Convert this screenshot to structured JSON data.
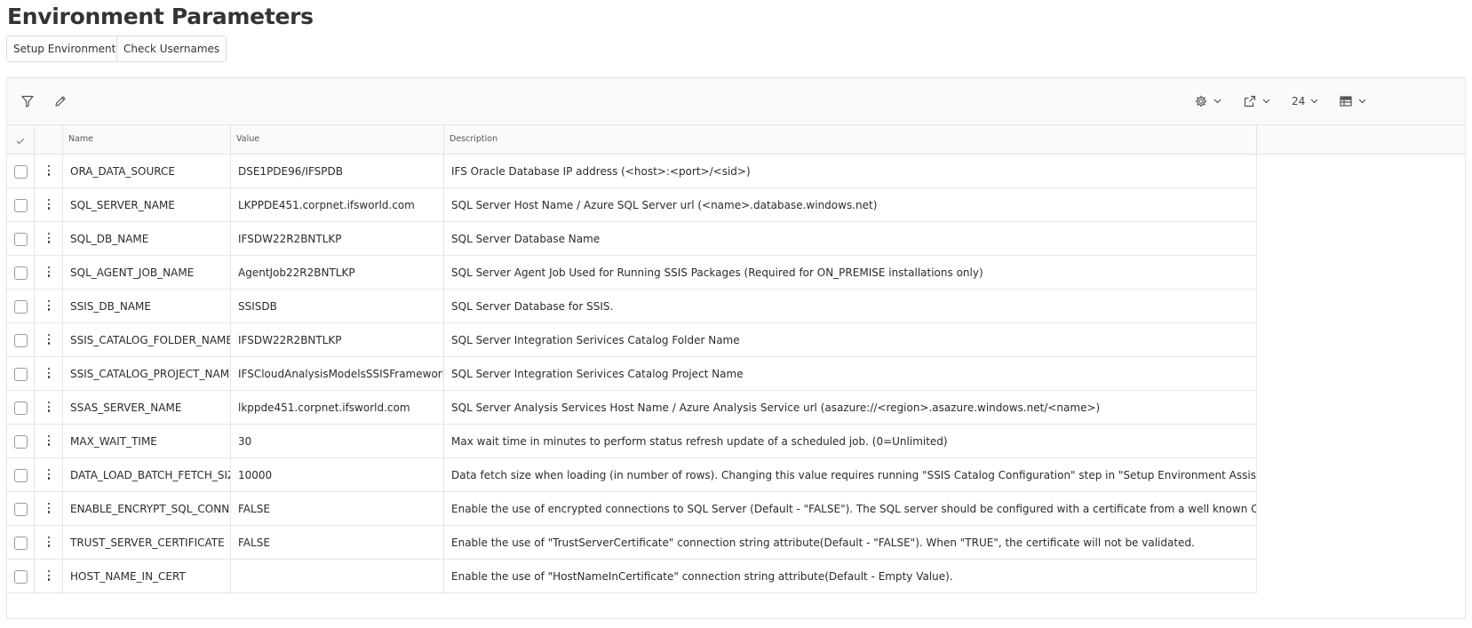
{
  "page": {
    "title": "Environment Parameters"
  },
  "commands": {
    "setup_environment": "Setup Environment",
    "check_usernames": "Check Usernames"
  },
  "toolbar": {
    "page_size": "24",
    "icons": [
      "filter-icon",
      "edit-icon",
      "settings-icon",
      "export-icon",
      "table-view-icon"
    ]
  },
  "table": {
    "columns": {
      "name": "Name",
      "value": "Value",
      "description": "Description"
    },
    "rows": [
      {
        "name": "ORA_DATA_SOURCE",
        "value": "DSE1PDE96/IFSPDB",
        "description": "IFS Oracle Database IP address (<host>:<port>/<sid>)"
      },
      {
        "name": "SQL_SERVER_NAME",
        "value": "LKPPDE451.corpnet.ifsworld.com",
        "description": "SQL Server Host Name / Azure SQL Server url (<name>.database.windows.net)"
      },
      {
        "name": "SQL_DB_NAME",
        "value": "IFSDW22R2BNTLKP",
        "description": "SQL Server Database Name"
      },
      {
        "name": "SQL_AGENT_JOB_NAME",
        "value": "AgentJob22R2BNTLKP",
        "description": "SQL Server Agent Job Used for Running SSIS Packages (Required for ON_PREMISE installations only)"
      },
      {
        "name": "SSIS_DB_NAME",
        "value": "SSISDB",
        "description": "SQL Server Database for SSIS."
      },
      {
        "name": "SSIS_CATALOG_FOLDER_NAME",
        "value": "IFSDW22R2BNTLKP",
        "description": "SQL Server Integration Serivices Catalog Folder Name"
      },
      {
        "name": "SSIS_CATALOG_PROJECT_NAME",
        "value": "IFSCloudAnalysisModelsSSISFramework",
        "description": "SQL Server Integration Serivices Catalog Project Name"
      },
      {
        "name": "SSAS_SERVER_NAME",
        "value": "lkppde451.corpnet.ifsworld.com",
        "description": "SQL Server Analysis Services Host Name / Azure Analysis Service url (asazure://<region>.asazure.windows.net/<name>)"
      },
      {
        "name": "MAX_WAIT_TIME",
        "value": "30",
        "description": "Max wait time in minutes to perform status refresh update of a scheduled job. (0=Unlimited)"
      },
      {
        "name": "DATA_LOAD_BATCH_FETCH_SIZE",
        "value": "10000",
        "description": "Data fetch size when loading (in number of rows). Changing this value requires running \"SSIS Catalog Configuration\" step in \"Setup Environment Assistant\""
      },
      {
        "name": "ENABLE_ENCRYPT_SQL_CONN",
        "value": "FALSE",
        "description": "Enable the use of encrypted connections to SQL Server (Default - \"FALSE\"). The SQL server should be configured with a certificate from a well known CA"
      },
      {
        "name": "TRUST_SERVER_CERTIFICATE",
        "value": "FALSE",
        "description": "Enable the use of \"TrustServerCertificate\" connection string attribute(Default - \"FALSE\"). When \"TRUE\", the certificate will not be validated."
      },
      {
        "name": "HOST_NAME_IN_CERT",
        "value": "",
        "description": "Enable the use of \"HostNameInCertificate\" connection string attribute(Default - Empty Value)."
      }
    ]
  }
}
